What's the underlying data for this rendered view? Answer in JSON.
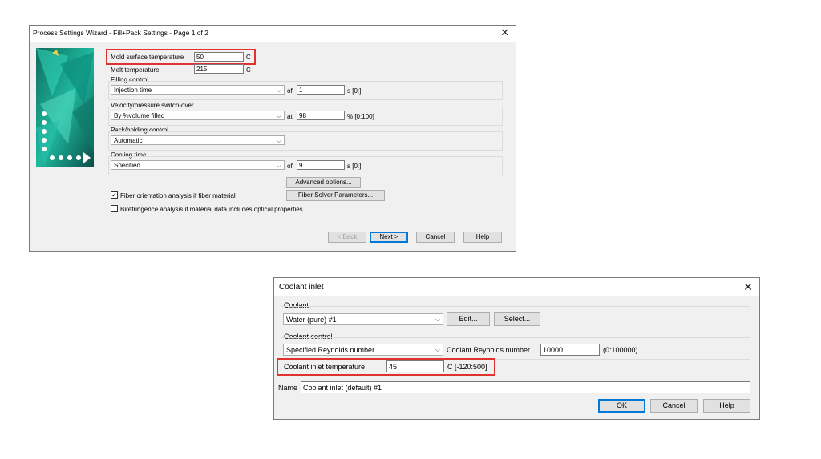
{
  "wizard": {
    "title": "Process Settings Wizard - Fill+Pack Settings - Page 1 of 2",
    "mold_temp": {
      "label": "Mold surface temperature",
      "value": "50",
      "unit": "C"
    },
    "melt_temp": {
      "label": "Melt temperature",
      "value": "215",
      "unit": "C"
    },
    "filling_control": {
      "group_label": "Filling control",
      "selected": "Injection time",
      "of_label": "of",
      "value": "1",
      "range": "s [0:]"
    },
    "vp_switch": {
      "group_label": "Velocity/pressure switch-over",
      "selected": "By %volume filled",
      "at_label": "at",
      "value": "98",
      "range": "% [0:100]"
    },
    "pack_control": {
      "group_label": "Pack/holding control",
      "selected": "Automatic"
    },
    "cooling_time": {
      "group_label": "Cooling time",
      "selected": "Specified",
      "of_label": "of",
      "value": "9",
      "range": "s [0:]"
    },
    "advanced_label": "Advanced options...",
    "fiber_solver_label": "Fiber Solver Parameters...",
    "fiber_check": {
      "label": "Fiber orientation analysis if fiber material",
      "checked": true
    },
    "birefringence_check": {
      "label": "Birefringence analysis if material data includes optical properties",
      "checked": false
    },
    "buttons": {
      "back": "< Back",
      "next": "Next >",
      "cancel": "Cancel",
      "help": "Help"
    }
  },
  "coolant": {
    "title": "Coolant inlet",
    "coolant_group": {
      "label": "Coolant",
      "selected": "Water (pure) #1",
      "edit": "Edit...",
      "select": "Select..."
    },
    "control_group": {
      "label": "Coolant control",
      "selected": "Specified Reynolds number",
      "reynolds_label": "Coolant Reynolds number",
      "reynolds_value": "10000",
      "reynolds_range": "(0:100000)"
    },
    "inlet_temp": {
      "label": "Coolant inlet temperature",
      "value": "45",
      "range": "C [-120:500]"
    },
    "name": {
      "label": "Name",
      "value": "Coolant inlet (default) #1"
    },
    "buttons": {
      "ok": "OK",
      "cancel": "Cancel",
      "help": "Help"
    }
  },
  "stray_mark": "."
}
